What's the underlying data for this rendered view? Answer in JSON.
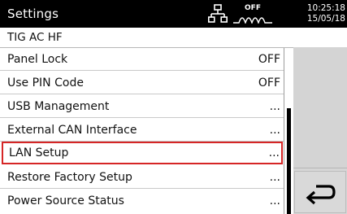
{
  "header": {
    "title": "Settings",
    "status": {
      "off_label": "OFF"
    },
    "time": "10:25:18",
    "date": "15/05/18"
  },
  "subheader": {
    "mode": "TIG AC HF"
  },
  "menu": {
    "items": [
      {
        "label": "Panel Lock",
        "value": "OFF"
      },
      {
        "label": "Use PIN Code",
        "value": "OFF"
      },
      {
        "label": "USB Management",
        "value": "..."
      },
      {
        "label": "External CAN Interface",
        "value": "..."
      },
      {
        "label": "LAN Setup",
        "value": "...",
        "selected": true
      },
      {
        "label": "Restore Factory Setup",
        "value": "..."
      },
      {
        "label": "Power Source Status",
        "value": "..."
      }
    ]
  },
  "icons": {
    "network": "network-icon",
    "wave": "wave-icon",
    "back": "back-arrow-icon"
  },
  "colors": {
    "header_bg": "#000000",
    "selection_border": "#d62626",
    "side_panel": "#d6d6d6"
  }
}
